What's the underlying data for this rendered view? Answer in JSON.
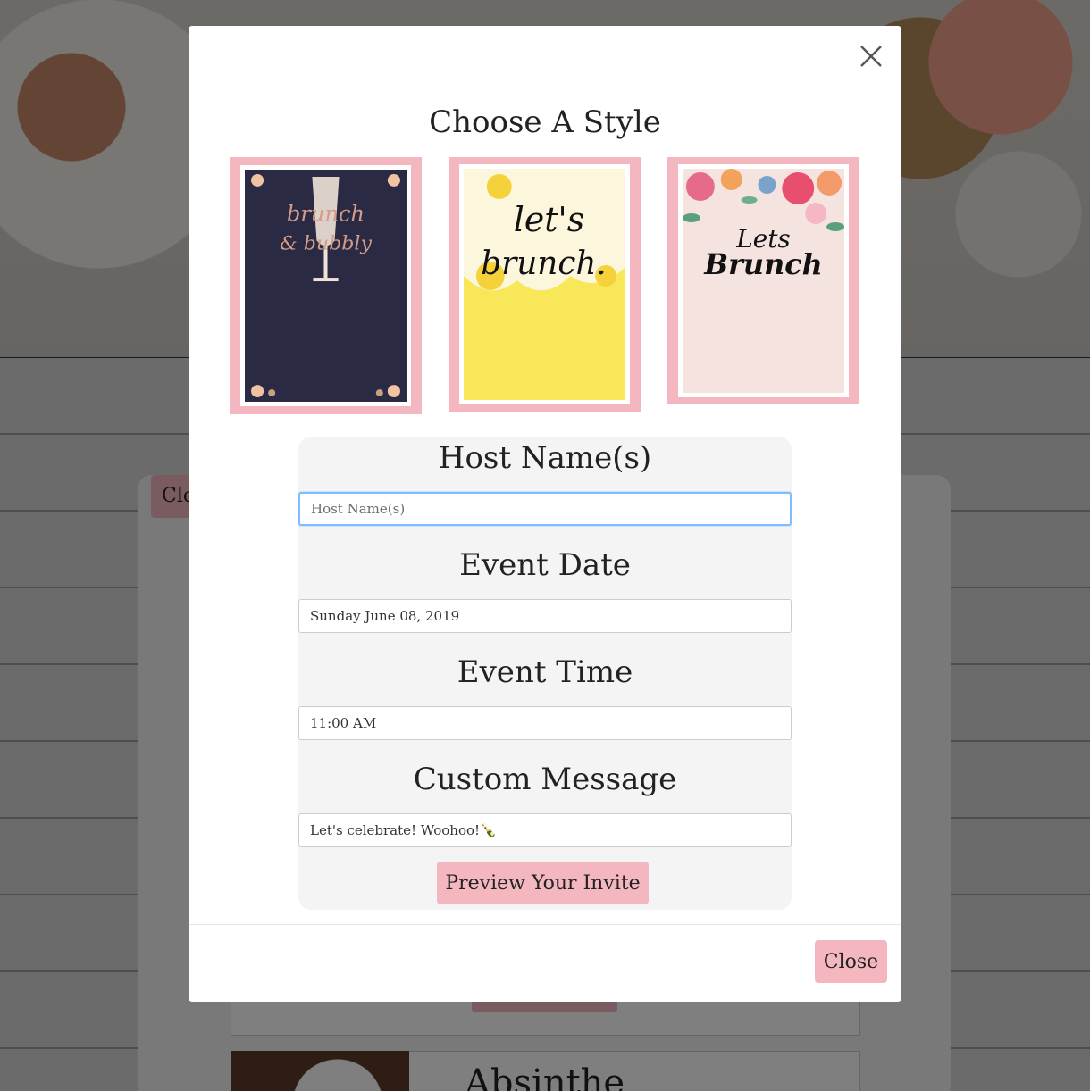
{
  "background": {
    "clear_button_label": "Clear",
    "recipe_title": "Absinthe"
  },
  "modal": {
    "title": "Choose A Style",
    "styles": [
      {
        "name": "brunch & bubbly",
        "art_text": "brunch & bubbly",
        "bg": "#2b2a45"
      },
      {
        "name": "lets brunch yellow",
        "art_text": "lets brunch.",
        "bg": "#f9e75a"
      },
      {
        "name": "Lets Brunch floral",
        "art_text": "Lets Brunch",
        "bg": "#f5e3e0"
      }
    ],
    "form": {
      "host_label": "Host Name(s)",
      "host_placeholder": "Host Name(s)",
      "host_value": "",
      "date_label": "Event Date",
      "date_value": "Sunday June 08, 2019",
      "time_label": "Event Time",
      "time_value": "11:00 AM",
      "message_label": "Custom Message",
      "message_value": "Let's celebrate! Woohoo!🍾",
      "preview_button_label": "Preview Your Invite"
    },
    "footer": {
      "close_button_label": "Close"
    }
  },
  "colors": {
    "accent_pink": "#f4b7c0",
    "focus_blue": "#80bdff"
  }
}
